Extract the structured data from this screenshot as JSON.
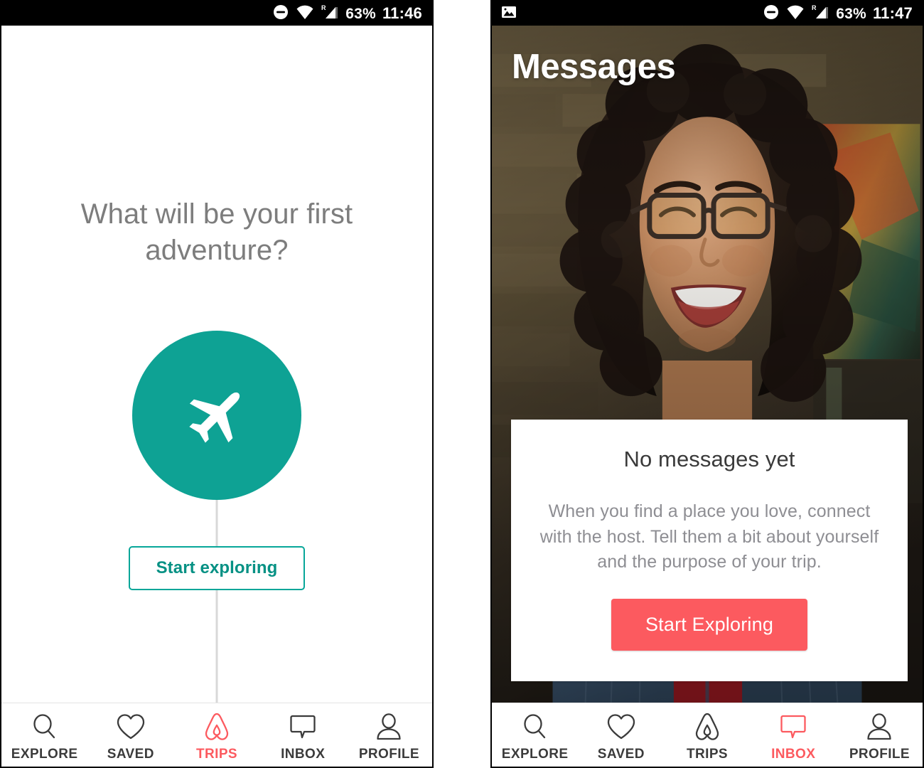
{
  "theme": {
    "accent_teal": "#0ea294",
    "accent_red": "#fc5a5f",
    "text_grey": "#7d7d7d",
    "nav_text": "#3b3b3b",
    "card_white": "#ffffff",
    "status_bar_black": "#000000"
  },
  "left_screen": {
    "status_bar": {
      "icons": [
        "do-not-disturb-icon",
        "wifi-icon",
        "cellular-roaming-icon"
      ],
      "battery": "63%",
      "time": "11:46"
    },
    "headline": "What will be your first adventure?",
    "plane_icon": "airplane-icon",
    "start_button_label": "Start exploring",
    "bottom_nav": {
      "active": "TRIPS",
      "items": [
        {
          "label": "EXPLORE",
          "icon": "search-icon"
        },
        {
          "label": "SAVED",
          "icon": "heart-icon"
        },
        {
          "label": "TRIPS",
          "icon": "airbnb-belo-icon"
        },
        {
          "label": "INBOX",
          "icon": "speech-bubble-icon"
        },
        {
          "label": "PROFILE",
          "icon": "person-icon"
        }
      ]
    }
  },
  "right_screen": {
    "status_bar": {
      "icons": [
        "photo-notification-icon",
        "do-not-disturb-icon",
        "wifi-icon",
        "cellular-roaming-icon"
      ],
      "battery": "63%",
      "time": "11:47"
    },
    "header_title": "Messages",
    "background_photo": "smiling-woman-with-glasses-denim-shirt-brick-wall",
    "card": {
      "title": "No messages yet",
      "body": "When you find a place you love, connect with the host. Tell them a bit about yourself and the purpose of your trip.",
      "button_label": "Start Exploring"
    },
    "bottom_nav": {
      "active": "INBOX",
      "items": [
        {
          "label": "EXPLORE",
          "icon": "search-icon"
        },
        {
          "label": "SAVED",
          "icon": "heart-icon"
        },
        {
          "label": "TRIPS",
          "icon": "airbnb-belo-icon"
        },
        {
          "label": "INBOX",
          "icon": "speech-bubble-icon"
        },
        {
          "label": "PROFILE",
          "icon": "person-icon"
        }
      ]
    }
  }
}
